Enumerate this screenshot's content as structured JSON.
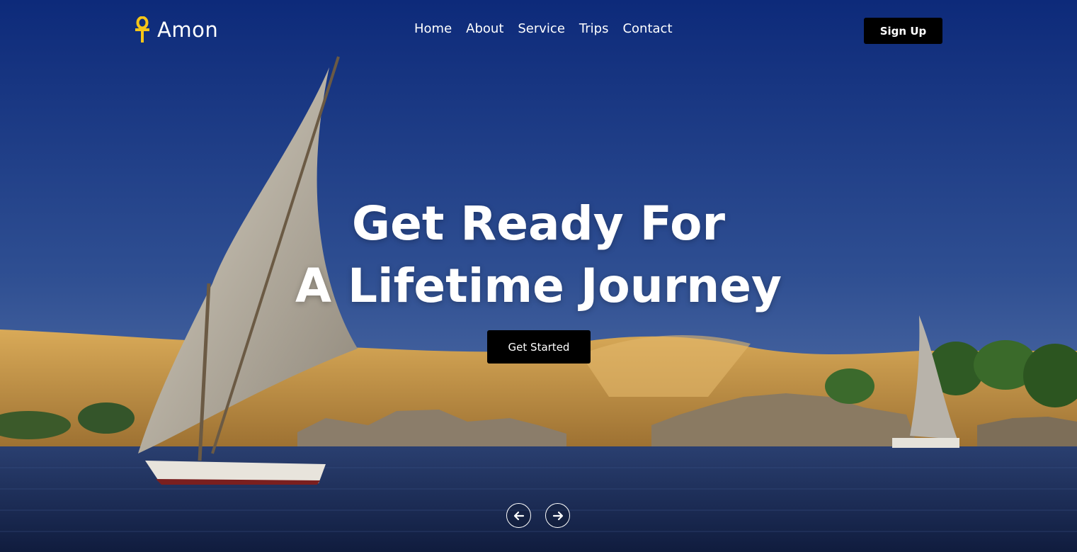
{
  "brand": {
    "name": "Amon",
    "icon": "ankh-icon",
    "icon_color": "#f5c518"
  },
  "nav": {
    "items": [
      {
        "label": "Home"
      },
      {
        "label": "About"
      },
      {
        "label": "Service"
      },
      {
        "label": "Trips"
      },
      {
        "label": "Contact"
      }
    ],
    "signup_label": "Sign Up"
  },
  "hero": {
    "headline_line1": "Get Ready For",
    "headline_line2": "A Lifetime Journey",
    "cta_label": "Get Started",
    "prev_icon": "arrow-left-icon",
    "next_icon": "arrow-right-icon"
  },
  "colors": {
    "sky_top": "#0e2a78",
    "sky_bottom": "#4a6aa3",
    "sand": "#c99a4a",
    "water": "#1d2f5c",
    "button_bg": "#000000",
    "text": "#ffffff"
  }
}
